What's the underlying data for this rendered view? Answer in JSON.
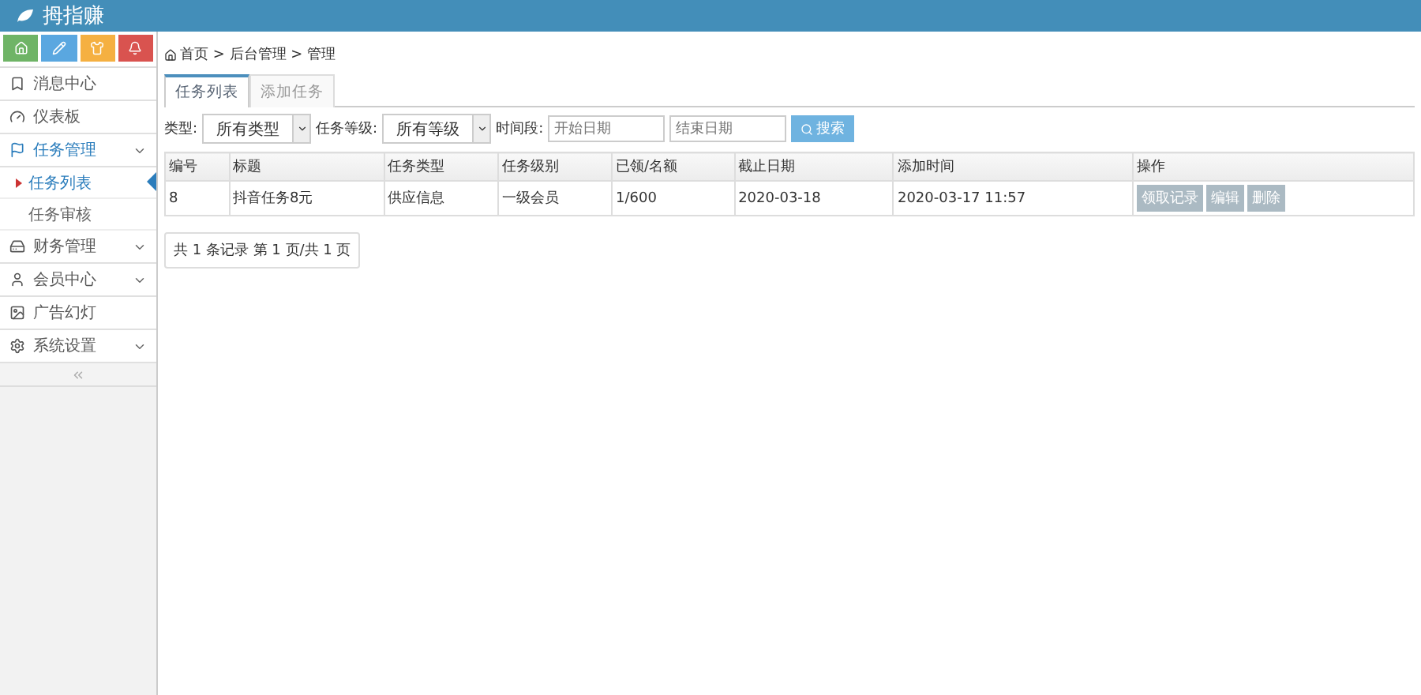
{
  "app": {
    "title": "拇指赚"
  },
  "quick_buttons": [
    {
      "color": "#6fb466"
    },
    {
      "color": "#5aa7e0"
    },
    {
      "color": "#f5b041"
    },
    {
      "color": "#d9534f"
    }
  ],
  "sidebar": {
    "items": [
      {
        "label": "消息中心",
        "kind": "link",
        "selected": false
      },
      {
        "label": "仪表板",
        "kind": "link",
        "selected": false
      },
      {
        "label": "任务管理",
        "kind": "group",
        "selected": true,
        "children": [
          {
            "label": "任务列表",
            "selected": true
          },
          {
            "label": "任务审核",
            "selected": false
          }
        ]
      },
      {
        "label": "财务管理",
        "kind": "group",
        "selected": false
      },
      {
        "label": "会员中心",
        "kind": "group",
        "selected": false
      },
      {
        "label": "广告幻灯",
        "kind": "link",
        "selected": false
      },
      {
        "label": "系统设置",
        "kind": "group",
        "selected": false
      }
    ]
  },
  "breadcrumb": "首页 > 后台管理 > 管理",
  "tabs": [
    {
      "label": "任务列表",
      "selected": true
    },
    {
      "label": "添加任务",
      "selected": false
    }
  ],
  "filters": {
    "type_label": "类型:",
    "type_value": "所有类型",
    "level_label": "任务等级:",
    "level_value": "所有等级",
    "time_label": "时间段:",
    "start_placeholder": "开始日期",
    "end_placeholder": "结束日期",
    "search": "搜索"
  },
  "table": {
    "columns": [
      "编号",
      "标题",
      "任务类型",
      "任务级别",
      "已领/名额",
      "截止日期",
      "添加时间",
      "操作"
    ],
    "rows": [
      {
        "cells": [
          "8",
          "抖音任务8元",
          "供应信息",
          "一级会员",
          "1/600",
          "2020-03-18",
          "2020-03-17 11:57"
        ],
        "actions": [
          "领取记录",
          "编辑",
          "删除"
        ]
      }
    ]
  },
  "pagination": "共 1 条记录 第 1 页/共 1 页"
}
